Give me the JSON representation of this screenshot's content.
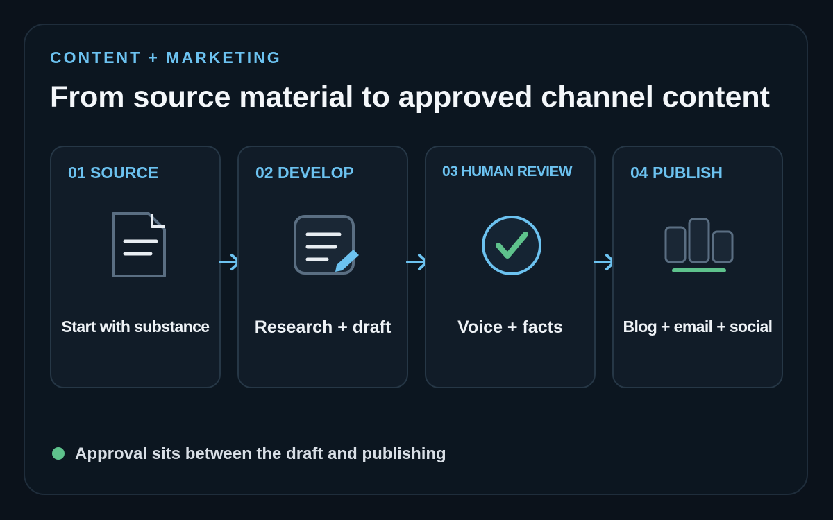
{
  "header": {
    "eyebrow": "CONTENT + MARKETING",
    "title": "From source material to approved channel content"
  },
  "steps": [
    {
      "label": "01 SOURCE",
      "caption": "Start with substance",
      "icon": "document-icon"
    },
    {
      "label": "02 DEVELOP",
      "caption": "Research + draft",
      "icon": "edit-draft-icon"
    },
    {
      "label": "03 HUMAN REVIEW",
      "caption": "Voice + facts",
      "icon": "check-circle-icon"
    },
    {
      "label": "04 PUBLISH",
      "caption": "Blog + email + social",
      "icon": "channels-icon"
    }
  ],
  "legend": {
    "text": "Approval sits between the draft and publishing",
    "color": "#5ec28c"
  },
  "colors": {
    "accent_blue": "#6cc2f0",
    "accent_green": "#5ec28c",
    "background": "#0b121b",
    "card": "#111c28"
  }
}
